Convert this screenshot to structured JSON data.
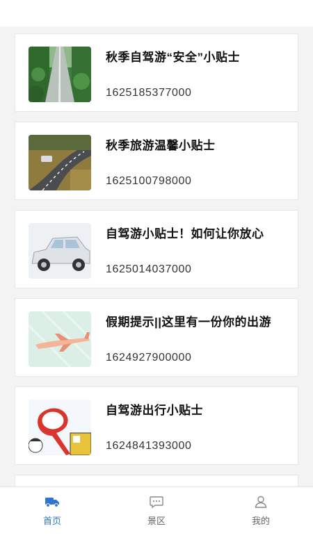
{
  "articles": [
    {
      "title": "秋季自驾游“安全”小贴士",
      "time": "1625185377000",
      "image": "forest-road"
    },
    {
      "title": "秋季旅游温馨小贴士",
      "time": "1625100798000",
      "image": "curved-road-car"
    },
    {
      "title": "自驾游小贴士！如何让你放心",
      "time": "1625014037000",
      "image": "white-car"
    },
    {
      "title": "假期提示||这里有一份你的出游",
      "time": "1624927900000",
      "image": "airplane"
    },
    {
      "title": "自驾游出行小贴士",
      "time": "1624841393000",
      "image": "road-sign-cartoon"
    }
  ],
  "tabs": [
    {
      "label": "首页",
      "icon": "truck-icon",
      "active": true
    },
    {
      "label": "景区",
      "icon": "chat-icon",
      "active": false
    },
    {
      "label": "我的",
      "icon": "user-icon",
      "active": false
    }
  ],
  "colors": {
    "accent": "#2f74d0",
    "background": "#f3f3f3"
  }
}
